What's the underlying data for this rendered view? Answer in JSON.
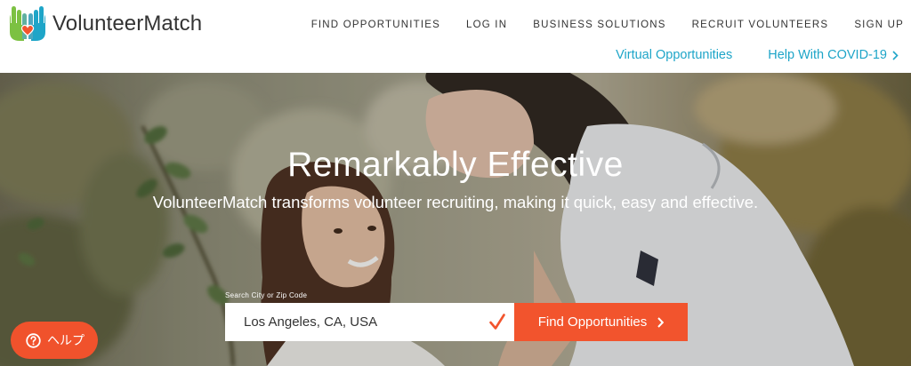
{
  "brand": {
    "name": "VolunteerMatch",
    "colors": {
      "green": "#7cc142",
      "blue": "#1ea5c8",
      "heart": "#f2542d",
      "accent": "#f2542d"
    }
  },
  "nav": {
    "items": [
      {
        "label": "FIND OPPORTUNITIES"
      },
      {
        "label": "LOG IN"
      },
      {
        "label": "BUSINESS SOLUTIONS"
      },
      {
        "label": "RECRUIT VOLUNTEERS"
      },
      {
        "label": "SIGN UP"
      }
    ]
  },
  "subnav": {
    "virtual": "Virtual Opportunities",
    "covid": "Help With COVID-19",
    "covid_icon": "chevron-right-icon"
  },
  "hero": {
    "title": "Remarkably Effective",
    "subtitle": "VolunteerMatch transforms volunteer recruiting, making it quick, easy and effective."
  },
  "search": {
    "label": "Search City or Zip Code",
    "value": "Los Angeles, CA, USA",
    "status_icon": "checkmark-icon",
    "button_label": "Find Opportunities",
    "button_icon": "chevron-right-icon"
  },
  "help": {
    "label": "ヘルプ",
    "icon": "question-circle-icon"
  }
}
